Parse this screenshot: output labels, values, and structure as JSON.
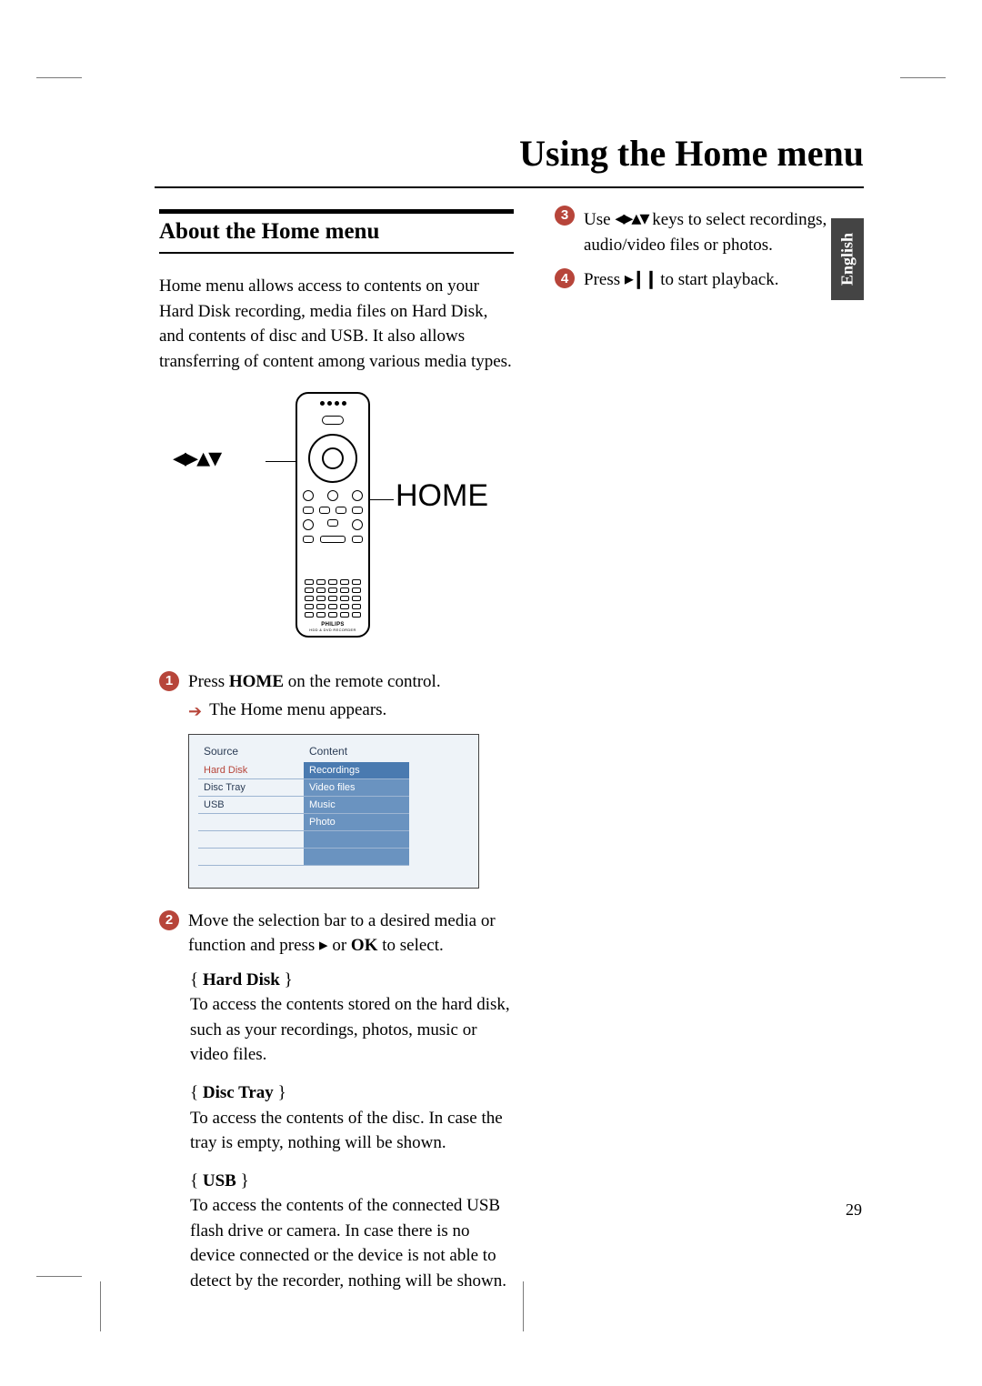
{
  "page_title": "Using the Home menu",
  "language_tab": "English",
  "page_number": "29",
  "section": {
    "heading": "About the Home menu",
    "intro": "Home menu allows access to contents on your Hard Disk recording, media files on Hard Disk, and contents of disc and USB. It also allows transferring of content among various media types."
  },
  "remote": {
    "left_label": "◂▸▴▾",
    "right_label": "HOME",
    "brand": "PHILIPS",
    "brand_sub": "HDD & DVD RECORDER"
  },
  "steps": {
    "s1_a": "Press ",
    "s1_bold": "HOME",
    "s1_b": " on the remote control.",
    "s1_sub": "The Home menu appears.",
    "s2_a": "Move the selection bar to a desired media or function and press ▸ or ",
    "s2_bold": "OK",
    "s2_b": " to select.",
    "s3_a": "Use ",
    "s3_arrows": "◂▸▴▾",
    "s3_b": " keys to select recordings, audio/video files or photos.",
    "s4_a": "Press ",
    "s4_icon": "▸❙❙",
    "s4_b": " to start playback."
  },
  "menu_ui": {
    "col1_header": "Source",
    "col2_header": "Content",
    "source_items": [
      "Hard Disk",
      "Disc Tray",
      "USB"
    ],
    "content_items": [
      "Recordings",
      "Video files",
      "Music",
      "Photo"
    ]
  },
  "options": {
    "hd_title": "Hard Disk",
    "hd_text": "To access the contents stored on the hard disk, such as your recordings, photos, music or video files.",
    "dt_title": "Disc Tray",
    "dt_text": "To access the contents of the disc. In case the tray is empty, nothing will be shown.",
    "usb_title": "USB",
    "usb_text": "To access the contents of the connected USB flash drive or camera.  In case there is no device connected or the device is not able to detect by the recorder, nothing will be shown."
  }
}
